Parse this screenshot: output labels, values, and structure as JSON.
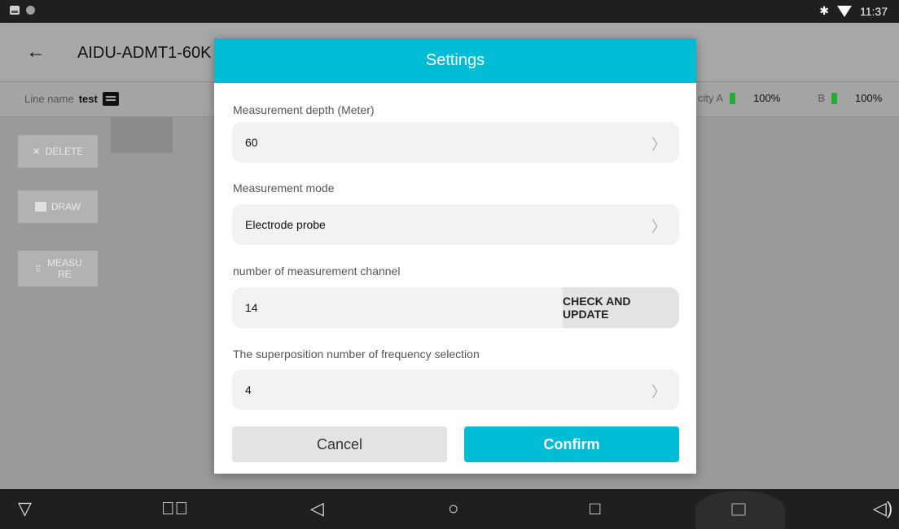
{
  "status_bar": {
    "time": "11:37",
    "bluetooth": "bluetooth-icon",
    "wifi": "wifi-icon"
  },
  "app_bar": {
    "back_icon": "←",
    "title": "AIDU-ADMT1-60K"
  },
  "info_bar": {
    "line_name_label": "Line name",
    "line_name_value": "test",
    "capacity_a_label": "city A",
    "capacity_a_value": "100%",
    "capacity_b_label": "B",
    "capacity_b_value": "100%"
  },
  "left_buttons": {
    "delete": "DELETE",
    "draw": "DRAW",
    "measure": "MEASU\nRE"
  },
  "dialog": {
    "title": "Settings",
    "fields": [
      {
        "label": "Measurement depth (Meter)",
        "value": "60"
      },
      {
        "label": "Measurement mode",
        "value": "Electrode probe"
      },
      {
        "label": "number of measurement channel",
        "value": "14",
        "action": "CHECK AND UPDATE"
      },
      {
        "label": "The superposition number of frequency selection",
        "value": "4"
      }
    ],
    "cancel": "Cancel",
    "confirm": "Confirm"
  },
  "colors": {
    "accent": "#00bcd4",
    "battery": "#1fae2f"
  }
}
